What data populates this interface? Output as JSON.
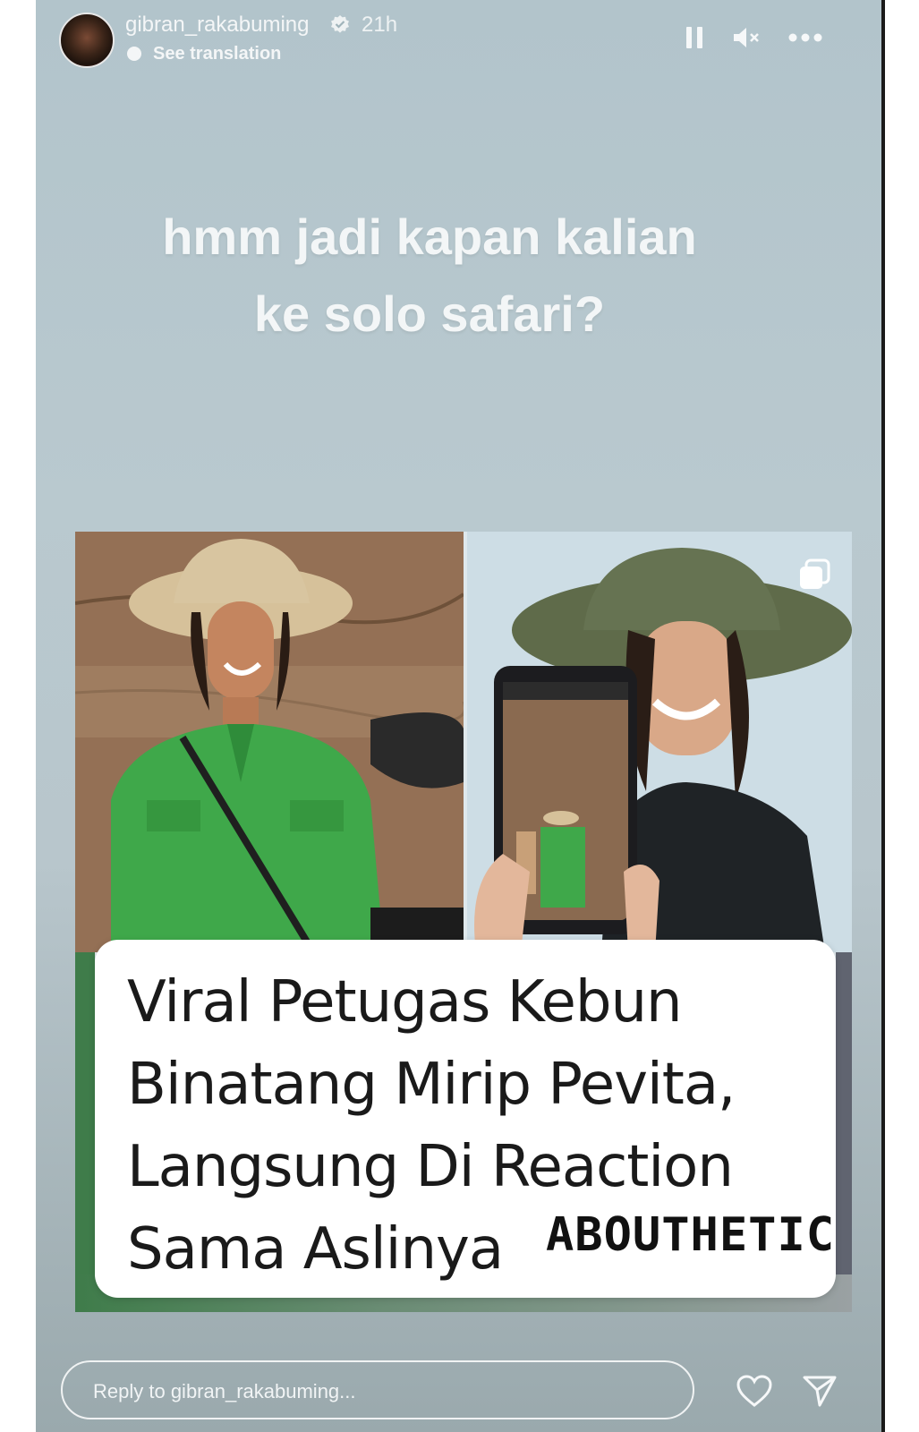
{
  "header": {
    "username": "gibran_rakabuming",
    "time": "21h",
    "translation_label": "See translation"
  },
  "story": {
    "caption_line1": "hmm jadi kapan kalian",
    "caption_line2": "ke solo safari?"
  },
  "card": {
    "headline_line1": "Viral Petugas Kebun",
    "headline_line2": "Binatang Mirip Pevita,",
    "headline_line3": "Langsung Di Reaction",
    "headline_line4": "Sama Aslinya",
    "brand": "ABOUTHETIC"
  },
  "reply": {
    "placeholder": "Reply to gibran_rakabuming..."
  },
  "icons": {
    "verified": "verified-badge-icon",
    "pause": "pause-icon",
    "mute": "speaker-muted-icon",
    "more": "more-dots-icon",
    "multi": "multiple-images-icon",
    "like": "heart-icon",
    "send": "paper-plane-icon"
  },
  "colors": {
    "background": "#b5c6cc",
    "text": "#f3f6f7",
    "headline_text": "#1a1a1a",
    "uniform_green": "#3fa84a"
  }
}
